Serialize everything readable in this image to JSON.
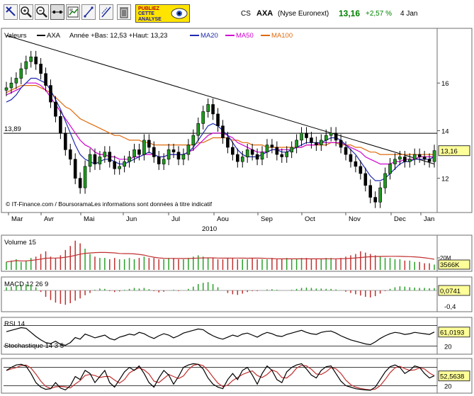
{
  "toolbar": {
    "tools": [
      "toolbar-icon-1",
      "zoom-in-icon",
      "zoom-out-icon",
      "horizontal-line-tool-icon",
      "chart-settings-icon",
      "trend-line-tool-icon",
      "trend-line-alt-tool-icon",
      "delete-icon"
    ],
    "promo_lines": [
      "PUBLIEZ",
      "CETTE",
      "ANALYSE"
    ],
    "promo_icon": "eye-icon"
  },
  "quote": {
    "market": "CS",
    "symbol": "AXA",
    "exchange": "(Nyse Euronext)",
    "price": "13,16",
    "change": "+2,57 %",
    "date": "4 Jan",
    "up_color": "#008000"
  },
  "main_panel": {
    "legend_prefix": "Valeurs",
    "legend_symbol": "AXA",
    "legend_range": "Année +Bas: 12,53 +Haut: 13,23",
    "ma20_label": "MA20",
    "ma50_label": "MA50",
    "ma100_label": "MA100",
    "ma20_color": "#1f2ab0",
    "ma50_color": "#d000d0",
    "ma100_color": "#e06a0c",
    "hline_label": "13,89",
    "last_price": "13,16",
    "copyright": "© IT-Finance.com / BoursoramaLes informations sont données à titre indicatif",
    "y_ticks": [
      "16",
      "14",
      "12"
    ],
    "months": [
      "Mar",
      "Avr",
      "Mai",
      "Jun",
      "Jul",
      "Aou",
      "Sep",
      "Oct",
      "Nov",
      "Dec",
      "Jan"
    ],
    "year": "2010"
  },
  "volume_panel": {
    "title": "Volume 15",
    "tick_label": "20M",
    "last_value": "3566K"
  },
  "macd_panel": {
    "title": "MACD 12 26 9",
    "last_value": "0,0741",
    "tick_label": "-0,4"
  },
  "rsi_panel": {
    "title": "RSI 14",
    "last_value": "61,0193",
    "tick_label": "20"
  },
  "stoch_panel": {
    "title": "Stochastique 14 3 5",
    "last_value": "52,5638",
    "tick_label": "20"
  },
  "chart_data": {
    "type": "candlestick",
    "title": "AXA",
    "y_range_main": [
      10.8,
      18.0
    ],
    "x_labels": [
      "Mar",
      "Avr",
      "Mai",
      "Jun",
      "Jul",
      "Aou",
      "Sep",
      "Oct",
      "Nov",
      "Dec",
      "Jan"
    ],
    "reference_line": 13.89,
    "last_price": 13.16,
    "close_series": [
      15.8,
      16.0,
      16.2,
      16.6,
      16.9,
      17.1,
      16.8,
      16.4,
      15.9,
      15.2,
      14.6,
      13.9,
      13.2,
      12.8,
      12.0,
      11.6,
      12.5,
      13.0,
      12.6,
      12.9,
      13.1,
      12.7,
      12.4,
      12.5,
      12.7,
      12.9,
      13.2,
      13.0,
      13.6,
      13.3,
      12.9,
      12.6,
      12.8,
      13.2,
      13.1,
      12.8,
      13.0,
      13.4,
      13.8,
      14.3,
      14.8,
      15.1,
      14.7,
      14.2,
      13.7,
      13.3,
      13.0,
      12.7,
      12.9,
      13.2,
      13.0,
      12.8,
      13.1,
      13.4,
      13.3,
      13.0,
      12.9,
      13.1,
      13.3,
      13.6,
      13.9,
      13.7,
      13.5,
      13.4,
      13.6,
      13.8,
      13.9,
      13.6,
      13.3,
      13.0,
      12.7,
      12.5,
      12.2,
      11.7,
      11.2,
      11.0,
      11.6,
      12.2,
      12.6,
      12.8,
      12.9,
      12.7,
      12.8,
      13.0,
      12.9,
      12.8,
      12.7,
      13.16
    ],
    "ma20": [
      15.2,
      15.3,
      15.5,
      15.8,
      16.0,
      16.2,
      16.2,
      16.1,
      16.0,
      15.7,
      15.3,
      14.9,
      14.4,
      13.9,
      13.4,
      13.0,
      12.8,
      12.7,
      12.6,
      12.7,
      12.8,
      12.8,
      12.7,
      12.6,
      12.6,
      12.7,
      12.8,
      12.9,
      13.0,
      13.1,
      13.0,
      12.9,
      12.9,
      13.0,
      13.0,
      13.0,
      13.0,
      13.1,
      13.3,
      13.6,
      13.9,
      14.2,
      14.3,
      14.2,
      14.0,
      13.8,
      13.5,
      13.2,
      13.0,
      12.9,
      12.9,
      12.9,
      13.0,
      13.1,
      13.2,
      13.2,
      13.1,
      13.1,
      13.2,
      13.3,
      13.4,
      13.5,
      13.5,
      13.5,
      13.5,
      13.6,
      13.7,
      13.7,
      13.6,
      13.4,
      13.2,
      13.0,
      12.7,
      12.4,
      12.1,
      11.9,
      11.9,
      12.0,
      12.2,
      12.4,
      12.6,
      12.7,
      12.7,
      12.8,
      12.8,
      12.8,
      12.8,
      12.9
    ],
    "ma50": [
      15.5,
      15.6,
      15.7,
      15.8,
      16.0,
      16.0,
      16.0,
      15.9,
      15.7,
      15.4,
      15.1,
      14.8,
      14.5,
      14.2,
      13.9,
      13.6,
      13.4,
      13.3,
      13.1,
      13.0,
      13.0,
      12.9,
      12.9,
      12.8,
      12.8,
      12.8,
      12.9,
      12.9,
      13.0,
      13.0,
      13.0,
      12.9,
      12.9,
      13.0,
      13.0,
      13.0,
      13.0,
      13.1,
      13.2,
      13.4,
      13.6,
      13.8,
      13.9,
      13.9,
      13.9,
      13.8,
      13.7,
      13.5,
      13.4,
      13.3,
      13.2,
      13.1,
      13.1,
      13.1,
      13.2,
      13.2,
      13.2,
      13.2,
      13.2,
      13.3,
      13.3,
      13.4,
      13.4,
      13.4,
      13.5,
      13.5,
      13.5,
      13.5,
      13.5,
      13.4,
      13.3,
      13.2,
      13.1,
      12.9,
      12.8,
      12.7,
      12.6,
      12.6,
      12.6,
      12.7,
      12.7,
      12.8,
      12.8,
      12.8,
      12.9,
      12.9,
      12.9,
      12.9
    ],
    "ma100": [
      15.6,
      15.7,
      15.8,
      15.9,
      15.9,
      15.9,
      15.9,
      15.8,
      15.7,
      15.6,
      15.4,
      15.2,
      15.0,
      14.9,
      14.7,
      14.5,
      14.4,
      14.3,
      14.2,
      14.1,
      14.0,
      13.9,
      13.8,
      13.8,
      13.7,
      13.6,
      13.6,
      13.6,
      13.5,
      13.5,
      13.4,
      13.4,
      13.4,
      13.4,
      13.4,
      13.4,
      13.4,
      13.4,
      13.4,
      13.5,
      13.5,
      13.6,
      13.7,
      13.7,
      13.7,
      13.7,
      13.6,
      13.6,
      13.5,
      13.5,
      13.4,
      13.4,
      13.4,
      13.3,
      13.3,
      13.3,
      13.3,
      13.3,
      13.3,
      13.3,
      13.3,
      13.4,
      13.4,
      13.4,
      13.4,
      13.4,
      13.5,
      13.5,
      13.4,
      13.4,
      13.4,
      13.3,
      13.3,
      13.2,
      13.1,
      13.1,
      13.0,
      13.0,
      13.0,
      13.0,
      13.0,
      13.0,
      13.0,
      13.0,
      13.0,
      13.0,
      13.0,
      13.0
    ],
    "trendline": [
      [
        0,
        18.0
      ],
      [
        87,
        12.6
      ]
    ],
    "volume": [
      6,
      7,
      8,
      6,
      7,
      9,
      10,
      12,
      14,
      10,
      9,
      11,
      15,
      18,
      22,
      20,
      16,
      12,
      10,
      9,
      9,
      8,
      9,
      8,
      8,
      9,
      8,
      9,
      10,
      9,
      9,
      8,
      8,
      9,
      9,
      8,
      8,
      9,
      10,
      11,
      10,
      9,
      9,
      8,
      8,
      9,
      9,
      8,
      8,
      8,
      9,
      8,
      8,
      8,
      9,
      8,
      8,
      9,
      8,
      8,
      9,
      9,
      8,
      8,
      8,
      9,
      9,
      8,
      9,
      10,
      11,
      12,
      14,
      13,
      12,
      11,
      10,
      9,
      9,
      8,
      8,
      7,
      7,
      6,
      6,
      5,
      5,
      4
    ],
    "macd": [
      0.1,
      0.12,
      0.15,
      0.18,
      0.2,
      0.18,
      0.1,
      -0.05,
      -0.2,
      -0.3,
      -0.38,
      -0.42,
      -0.45,
      -0.4,
      -0.32,
      -0.25,
      -0.15,
      -0.08,
      0.02,
      0.06,
      0.05,
      -0.02,
      -0.05,
      -0.03,
      0.02,
      0.05,
      0.08,
      0.06,
      0.08,
      0.04,
      -0.02,
      -0.06,
      -0.04,
      0.0,
      0.02,
      -0.02,
      0.0,
      0.05,
      0.12,
      0.2,
      0.24,
      0.26,
      0.2,
      0.1,
      0.0,
      -0.08,
      -0.12,
      -0.14,
      -0.1,
      -0.05,
      -0.02,
      -0.02,
      0.0,
      0.03,
      0.04,
      0.02,
      0.0,
      0.0,
      0.02,
      0.05,
      0.08,
      0.09,
      0.08,
      0.06,
      0.06,
      0.05,
      0.05,
      0.03,
      0.0,
      -0.04,
      -0.08,
      -0.12,
      -0.16,
      -0.2,
      -0.22,
      -0.18,
      -0.1,
      -0.02,
      0.05,
      0.1,
      0.13,
      0.12,
      0.1,
      0.09,
      0.08,
      0.08,
      0.07,
      0.0741
    ],
    "rsi": [
      62,
      66,
      70,
      74,
      72,
      60,
      48,
      38,
      30,
      27,
      34,
      25,
      22,
      30,
      45,
      40,
      55,
      50,
      44,
      48,
      52,
      42,
      38,
      46,
      50,
      55,
      52,
      60,
      56,
      48,
      42,
      50,
      56,
      52,
      44,
      50,
      58,
      62,
      66,
      70,
      68,
      58,
      50,
      44,
      40,
      46,
      52,
      48,
      55,
      58,
      52,
      46,
      54,
      60,
      56,
      50,
      48,
      54,
      58,
      62,
      66,
      60,
      56,
      54,
      60,
      63,
      64,
      58,
      50,
      44,
      38,
      34,
      30,
      26,
      24,
      32,
      42,
      50,
      56,
      60,
      58,
      54,
      56,
      60,
      58,
      56,
      54,
      61
    ],
    "stoch": [
      70,
      80,
      88,
      90,
      84,
      60,
      30,
      15,
      8,
      10,
      30,
      12,
      6,
      20,
      50,
      40,
      70,
      60,
      30,
      50,
      70,
      30,
      15,
      40,
      65,
      80,
      70,
      85,
      60,
      30,
      15,
      45,
      70,
      55,
      25,
      50,
      80,
      88,
      92,
      90,
      75,
      45,
      25,
      15,
      10,
      40,
      60,
      40,
      70,
      80,
      55,
      25,
      60,
      85,
      70,
      40,
      30,
      65,
      80,
      88,
      92,
      75,
      55,
      45,
      70,
      82,
      85,
      60,
      35,
      20,
      15,
      10,
      8,
      6,
      5,
      15,
      40,
      65,
      82,
      88,
      80,
      60,
      70,
      85,
      80,
      60,
      45,
      52.5638
    ]
  }
}
